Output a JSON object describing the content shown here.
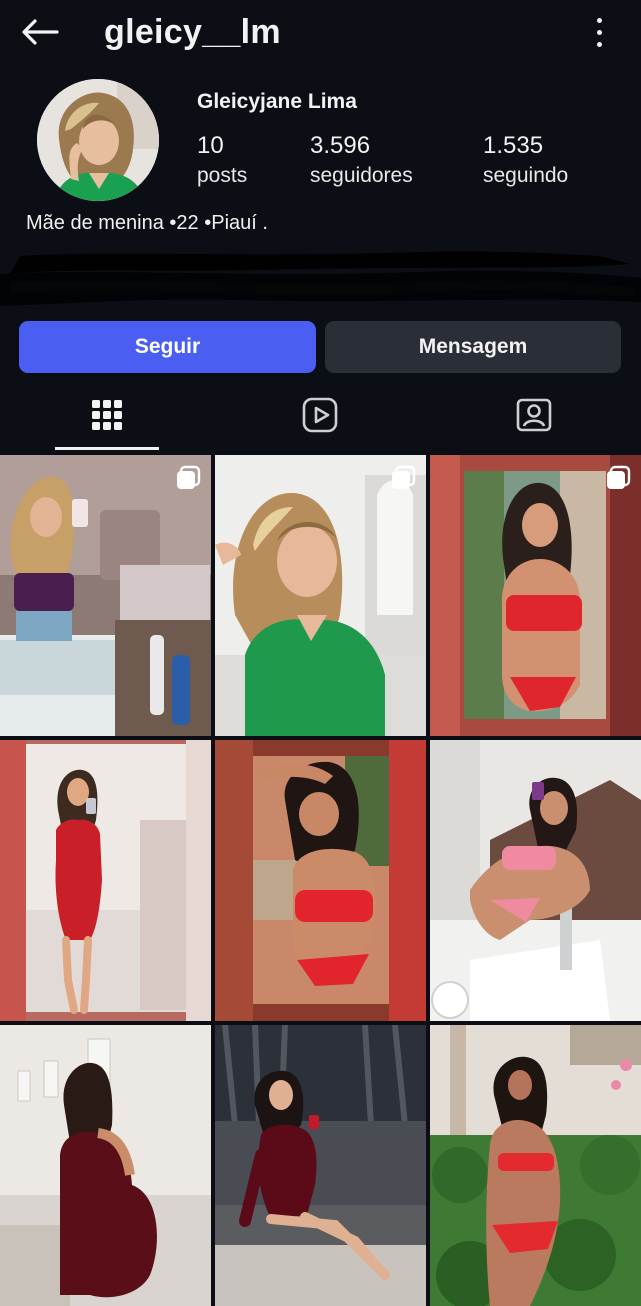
{
  "header": {
    "username": "gleicy__lm"
  },
  "profile": {
    "full_name": "Gleicyjane Lima",
    "stats": [
      {
        "value": "10",
        "label": "posts"
      },
      {
        "value": "3.596",
        "label": "seguidores"
      },
      {
        "value": "1.535",
        "label": "seguindo"
      }
    ],
    "bio": "Mãe de menina •22 •Piauí ."
  },
  "actions": {
    "follow_label": "Seguir",
    "message_label": "Mensagem"
  },
  "tabs": [
    {
      "icon": "grid-icon",
      "active": true
    },
    {
      "icon": "reels-icon",
      "active": false
    },
    {
      "icon": "tagged-icon",
      "active": false
    }
  ],
  "posts": [
    {
      "multiple": true
    },
    {
      "multiple": true
    },
    {
      "multiple": true
    },
    {
      "multiple": false
    },
    {
      "multiple": false
    },
    {
      "multiple": false
    },
    {
      "multiple": false
    },
    {
      "multiple": false
    },
    {
      "multiple": false
    }
  ],
  "colors": {
    "background": "#0b0e14",
    "follow_button": "#4a5ff2",
    "message_button": "#2a2e36",
    "text": "#f2f2f2"
  }
}
